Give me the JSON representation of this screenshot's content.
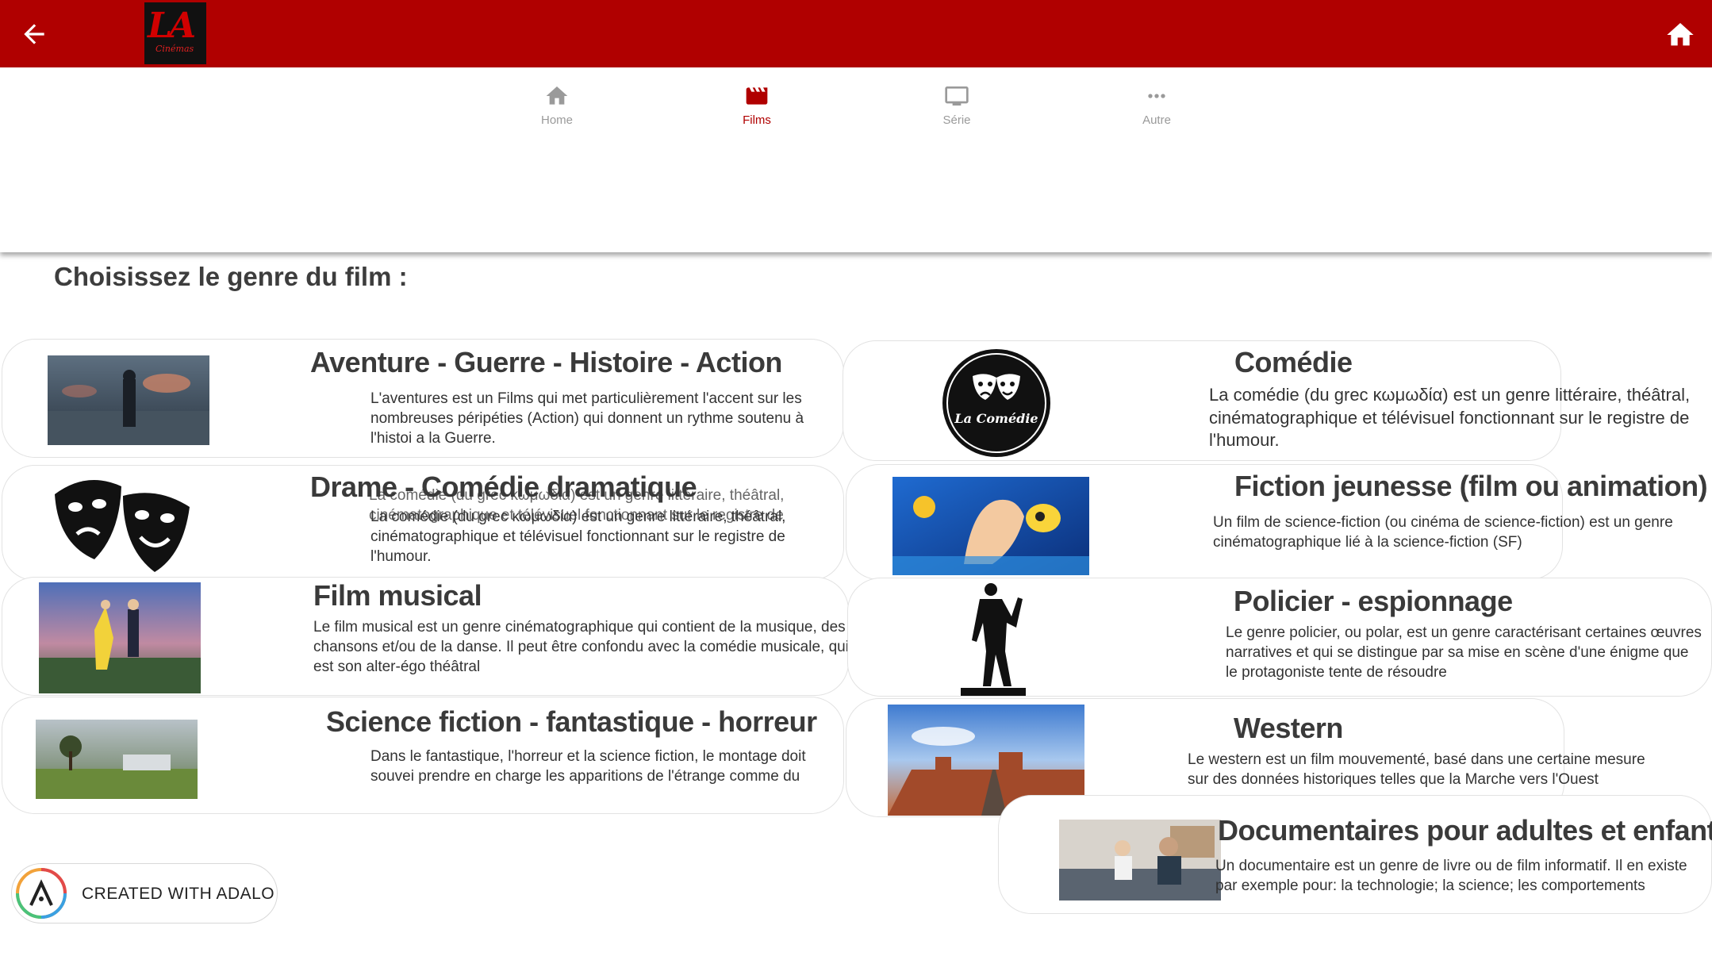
{
  "header": {
    "back_icon": "arrow-left-icon",
    "home_icon": "home-icon",
    "logo_text": "LA",
    "logo_subtext": "Cinémas",
    "background_color": "#b00000"
  },
  "tabs": [
    {
      "label": "Home",
      "icon": "home-icon",
      "active": false
    },
    {
      "label": "Films",
      "icon": "clapperboard-icon",
      "active": true
    },
    {
      "label": "Série",
      "icon": "tv-icon",
      "active": false
    },
    {
      "label": "Autre",
      "icon": "more-horizontal-icon",
      "active": false
    }
  ],
  "page_title": "Choisissez le genre du film :",
  "genres": {
    "aventure": {
      "title": "Aventure - Guerre - Histoire - Action",
      "description": "L'aventures est un Films qui met particulièrement l'accent sur les nombreuses péripéties (Action) qui donnent un rythme soutenu à l'histoi a la Guerre."
    },
    "comedie": {
      "title": "Comédie",
      "description": "La comédie (du grec κωμωδία) est un genre littéraire, théâtral, cinématographique et télévisuel fonctionnant sur le registre de l'humour.",
      "badge_text": "La Comédie"
    },
    "drame": {
      "title": "Drame - Comédie dramatique",
      "description": "La comédie (du grec κωμωδία) est un genre littéraire, théâtral, cinématographique et télévisuel fonctionnant sur le registre de l'humour.",
      "description_ghost": "La comédie (du grec κωμωδία) est un genre littéraire, théâtral, cinématographique et télévisuel fonctionnant sur le registre de l'humour."
    },
    "fiction_jeunesse": {
      "title": "Fiction jeunesse (film ou animation)",
      "description": "Un film de science-fiction (ou cinéma de science-fiction) est un genre cinématographique lié à la science-fiction (SF)"
    },
    "musical": {
      "title": "Film musical",
      "description": "Le film musical est un genre cinématographique qui contient de la musique, des chansons et/ou de la danse. Il peut être confondu avec la comédie musicale, qui est son alter-égo théâtral"
    },
    "policier": {
      "title": "Policier - espionnage",
      "description": "Le genre policier, ou polar, est un genre caractérisant certaines œuvres narratives et qui se distingue par sa mise en scène d'une énigme que le protagoniste tente de résoudre"
    },
    "science_fiction": {
      "title": "Science fiction - fantastique - horreur",
      "description": "Dans le fantastique, l'horreur et la science fiction, le montage doit souvei prendre en charge les apparitions de l'étrange comme du monstrueux"
    },
    "western": {
      "title": "Western",
      "description": "Le western est un film mouvementé, basé dans une certaine mesure sur des données historiques telles que la Marche vers l'Ouest"
    },
    "documentaires": {
      "title": "Documentaires pour adultes et enfants",
      "description": "Un documentaire est un genre de livre ou de film informatif. Il en existe par exemple pour: la technologie; la science; les comportements"
    }
  },
  "adalo_badge": {
    "label": "CREATED WITH ADALO",
    "icon": "adalo-logo-icon"
  }
}
